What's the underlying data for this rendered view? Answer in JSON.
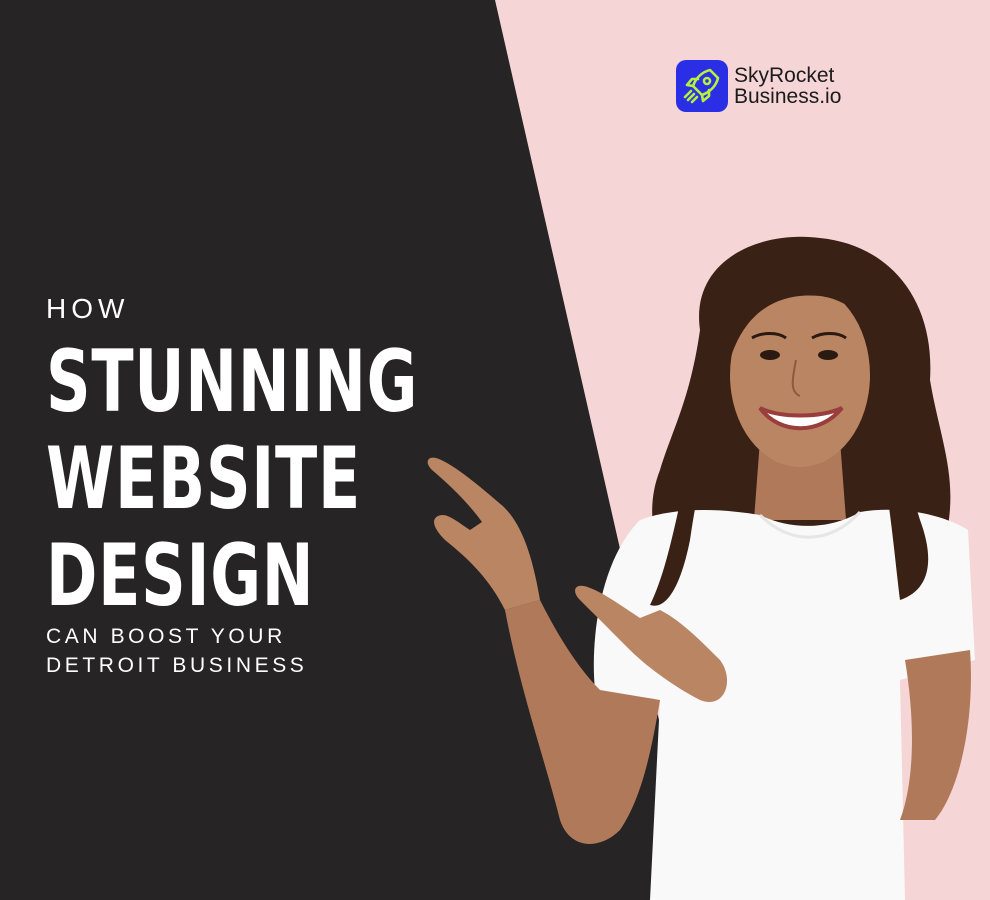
{
  "brand": {
    "line1": "SkyRocket",
    "line2": "Business.io",
    "icon": "rocket-icon",
    "badge_color": "#2a2fe6",
    "icon_color": "#b6f23a"
  },
  "headline": {
    "eyebrow": "HOW",
    "main_lines": [
      "STUNNING",
      "WEBSITE",
      "DESIGN"
    ],
    "sub_lines": [
      "CAN BOOST YOUR",
      "DETROIT BUSINESS"
    ]
  },
  "colors": {
    "dark_panel": "#262424",
    "pink_background": "#f6d5d7",
    "text": "#ffffff"
  }
}
